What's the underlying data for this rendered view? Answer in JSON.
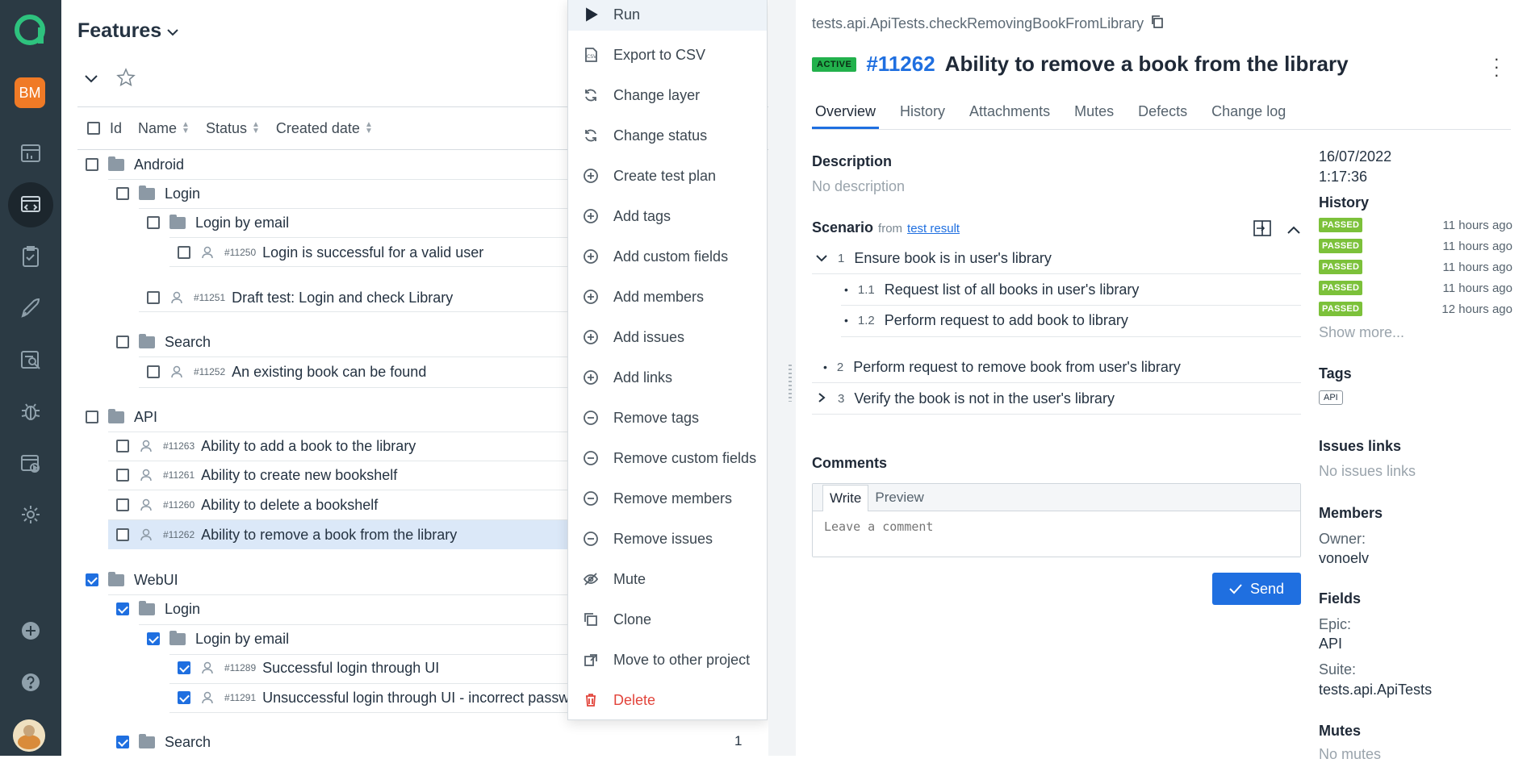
{
  "rail": {
    "user_initials": "BM"
  },
  "tree": {
    "title": "Features",
    "columns": {
      "id": "Id",
      "name": "Name",
      "status": "Status",
      "created": "Created date"
    },
    "android": "Android",
    "android_login": "Login",
    "android_login_by_email": "Login by email",
    "tc_11250_id": "#11250",
    "tc_11250": "Login is successful for a valid user",
    "tc_11251_id": "#11251",
    "tc_11251": "Draft test: Login and check Library",
    "android_search": "Search",
    "tc_11252_id": "#11252",
    "tc_11252": "An existing book can be found",
    "api": "API",
    "tc_11263_id": "#11263",
    "tc_11263": "Ability to add a book to the library",
    "tc_11261_id": "#11261",
    "tc_11261": "Ability to create new bookshelf",
    "tc_11260_id": "#11260",
    "tc_11260": "Ability to delete a bookshelf",
    "tc_11262_id": "#11262",
    "tc_11262": "Ability to remove a book from the library",
    "webui": "WebUI",
    "webui_login": "Login",
    "webui_login_by_email": "Login by email",
    "tc_11289_id": "#11289",
    "tc_11289": "Successful login through UI",
    "tc_11291_id": "#11291",
    "tc_11291": "Unsuccessful login through UI - incorrect passwo",
    "webui_search": "Search",
    "webui_search_count": "1"
  },
  "menu": {
    "run": "Run",
    "export_csv": "Export to CSV",
    "change_layer": "Change layer",
    "change_status": "Change status",
    "create_test_plan": "Create test plan",
    "add_tags": "Add tags",
    "add_custom_fields": "Add custom fields",
    "add_members": "Add members",
    "add_issues": "Add issues",
    "add_links": "Add links",
    "remove_tags": "Remove tags",
    "remove_custom_fields": "Remove custom fields",
    "remove_members": "Remove members",
    "remove_issues": "Remove issues",
    "mute": "Mute",
    "clone": "Clone",
    "move": "Move to other project",
    "delete": "Delete"
  },
  "detail": {
    "path": "tests.api.ApiTests.checkRemovingBookFromLibrary",
    "status_badge": "ACTIVE",
    "id": "#11262",
    "title": "Ability to remove a book from the library",
    "tabs": [
      "Overview",
      "History",
      "Attachments",
      "Mutes",
      "Defects",
      "Change log"
    ],
    "description_label": "Description",
    "description_value": "No description",
    "scenario_label": "Scenario",
    "scenario_from": "from",
    "scenario_link": "test result",
    "steps": {
      "s1_num": "1",
      "s1": "Ensure book is in user's library",
      "s11_num": "1.1",
      "s11": "Request list of all books in user's library",
      "s12_num": "1.2",
      "s12": "Perform request to add book to library",
      "s2_num": "2",
      "s2": "Perform request to remove book from user's library",
      "s3_num": "3",
      "s3": "Verify the book is not in the user's library"
    },
    "comments_label": "Comments",
    "comment_tab_write": "Write",
    "comment_tab_preview": "Preview",
    "comment_placeholder": "Leave a comment",
    "send_label": "Send",
    "created_date": "16/07/2022",
    "created_time": "1:17:36",
    "history_label": "History",
    "history": [
      {
        "status": "PASSED",
        "time": "11 hours ago"
      },
      {
        "status": "PASSED",
        "time": "11 hours ago"
      },
      {
        "status": "PASSED",
        "time": "11 hours ago"
      },
      {
        "status": "PASSED",
        "time": "11 hours ago"
      },
      {
        "status": "PASSED",
        "time": "12 hours ago"
      }
    ],
    "show_more": "Show more...",
    "tags_label": "Tags",
    "tag_api": "API",
    "issues_label": "Issues links",
    "issues_value": "No issues links",
    "members_label": "Members",
    "owner_label": "Owner:",
    "owner_value": "vonoelv",
    "fields_label": "Fields",
    "epic_label": "Epic:",
    "epic_value": "API",
    "suite_label": "Suite:",
    "suite_value": "tests.api.ApiTests",
    "mutes_label": "Mutes",
    "mutes_value": "No mutes"
  },
  "colors": {
    "rail": "#2b3a44",
    "accent": "#1f6fe0",
    "active_badge": "#22b14c",
    "passed": "#7cc13a",
    "danger": "#e2453c",
    "brand": "#2ec27e"
  }
}
